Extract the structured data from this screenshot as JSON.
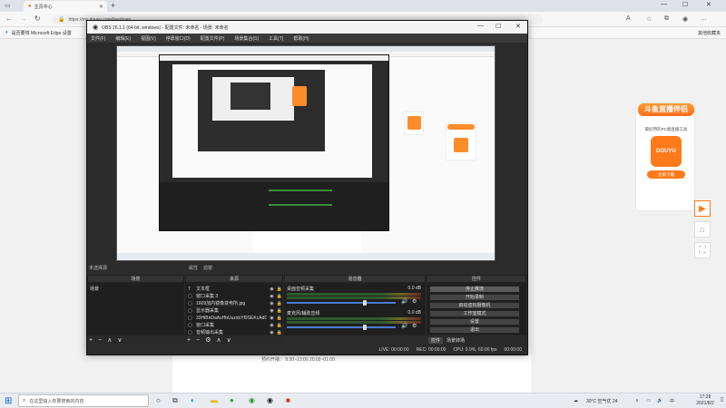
{
  "browser": {
    "tab_title": "主页中心",
    "url": "https://ms.douyu.com/live/main",
    "favorite_bar_item": "是否要将 Microsoft Edge 设置",
    "favorite_other": "其他收藏夹"
  },
  "page": {
    "schedule": "预约开播：  9:30~13:00 20:00~01:00"
  },
  "promo": {
    "title": "斗鱼直播伴侣",
    "subtitle": "最好用的PC端直播工具",
    "logo_text": "DOUYU",
    "button": "立即下载"
  },
  "obs": {
    "title": "OBS 26.1.1 (64-bit, windows) - 配置文件: 未命名 - 场景: 未命名",
    "menu": [
      "文件(F)",
      "编辑(E)",
      "视图(V)",
      "停靠窗口(D)",
      "配置文件(P)",
      "场景集合(S)",
      "工具(T)",
      "帮助(H)"
    ],
    "no_source": "未选择源",
    "properties": "属性",
    "filters": "滤镜",
    "docks": {
      "scenes": "场景",
      "sources": "来源",
      "mixer": "混音器",
      "controls": "控件"
    },
    "scene_items": [
      "场景"
    ],
    "sources": [
      {
        "icon": "T",
        "name": "文本框"
      },
      {
        "icon": "▢",
        "name": "窗口采集 3"
      },
      {
        "icon": "▢",
        "name": "1609加内镜像变电所.jpg"
      },
      {
        "icon": "▢",
        "name": "显示器采集"
      },
      {
        "icon": "▢",
        "name": "33HiBnDaAxHbUuzxbYf9SEKcAdDAx"
      },
      {
        "icon": "▢",
        "name": "窗口采集"
      },
      {
        "icon": "▢",
        "name": "音频输出采集"
      }
    ],
    "mixer": [
      {
        "name": "桌面音频采集",
        "db": "0.0 dB",
        "level": 0.72
      },
      {
        "name": "麦克风/辅助音频",
        "db": "0.0 dB",
        "level": 0.72
      }
    ],
    "controls": [
      "停止推流",
      "开始录制",
      "启动虚拟摄像机",
      "工作室模式",
      "设置",
      "退出"
    ],
    "controls_active_index": 0,
    "controls_tabs": [
      "控件",
      "场景转场"
    ],
    "status": [
      "LIVE: 00:00:00",
      "REC: 00:00:00",
      "CPU: 0.9%, 60.00 fps",
      "00:00:00"
    ]
  },
  "taskbar": {
    "search_placeholder": "在这里输入你要搜索的内容",
    "weather": "30°C 空气优 24",
    "time": "17:28",
    "date": "2021/8/2"
  }
}
